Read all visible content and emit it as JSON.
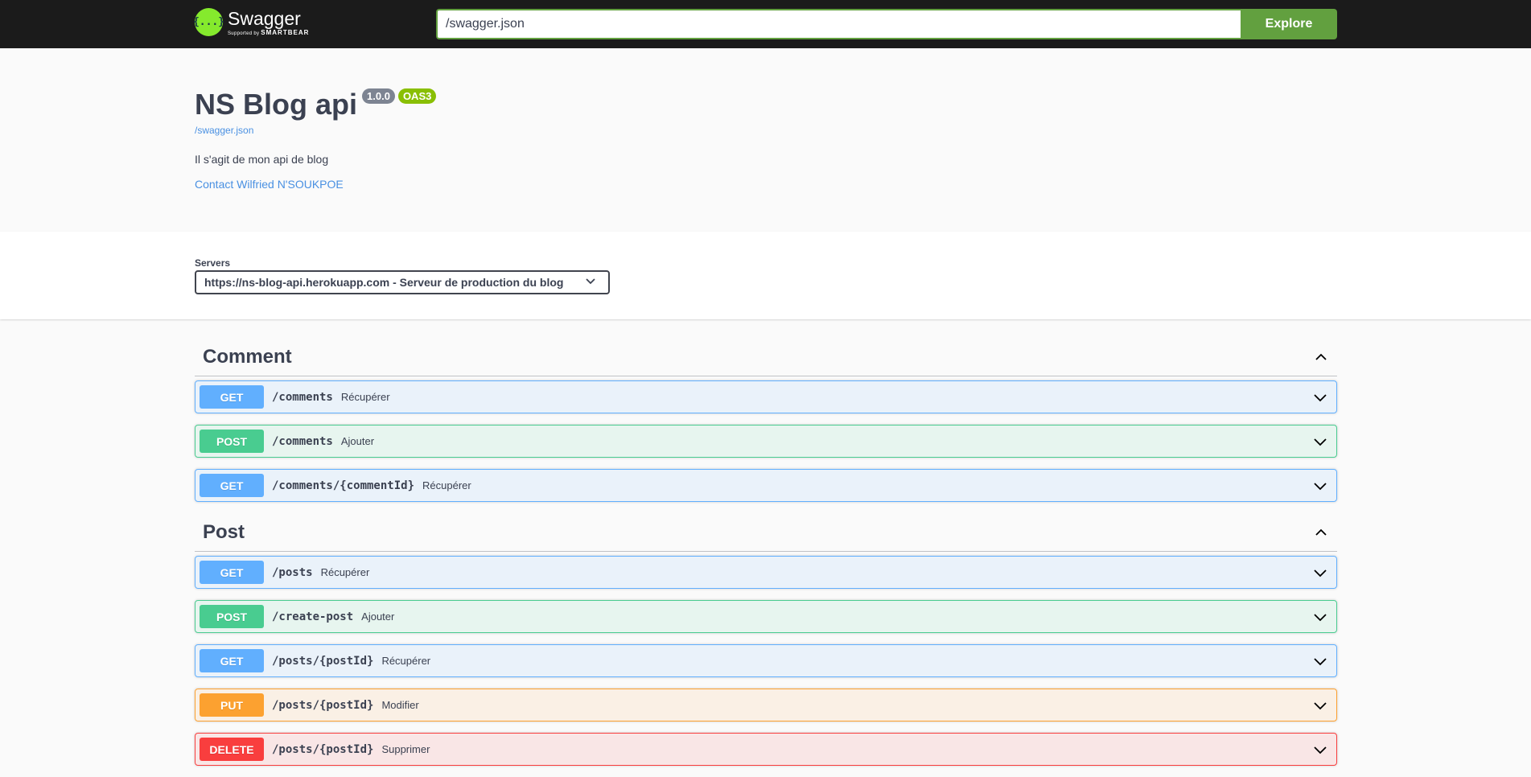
{
  "topbar": {
    "brand_name": "Swagger",
    "brand_sub_prefix": "Supported by",
    "brand_sub_company": "SMARTBEAR",
    "logo_glyph": "{...}",
    "url_value": "/swagger.json",
    "explore_label": "Explore"
  },
  "info": {
    "title": "NS Blog api",
    "version": "1.0.0",
    "oas_badge": "OAS3",
    "spec_url": "/swagger.json",
    "description": "Il s'agit de mon api de blog",
    "contact": "Contact Wilfried N'SOUKPOE"
  },
  "servers": {
    "label": "Servers",
    "selected": "https://ns-blog-api.herokuapp.com - Serveur de production du blog"
  },
  "tags": [
    {
      "name": "Comment",
      "operations": [
        {
          "method": "GET",
          "path": "/comments",
          "summary": "Récupérer"
        },
        {
          "method": "POST",
          "path": "/comments",
          "summary": "Ajouter"
        },
        {
          "method": "GET",
          "path": "/comments/{commentId}",
          "summary": "Récupérer"
        }
      ]
    },
    {
      "name": "Post",
      "operations": [
        {
          "method": "GET",
          "path": "/posts",
          "summary": "Récupérer"
        },
        {
          "method": "POST",
          "path": "/create-post",
          "summary": "Ajouter"
        },
        {
          "method": "GET",
          "path": "/posts/{postId}",
          "summary": "Récupérer"
        },
        {
          "method": "PUT",
          "path": "/posts/{postId}",
          "summary": "Modifier"
        },
        {
          "method": "DELETE",
          "path": "/posts/{postId}",
          "summary": "Supprimer"
        }
      ]
    }
  ],
  "colors": {
    "topbar_bg": "#1b1b1b",
    "explore_green": "#62a03f",
    "get": "#61affe",
    "post": "#49cc90",
    "put": "#fca130",
    "delete": "#f93e3e"
  }
}
